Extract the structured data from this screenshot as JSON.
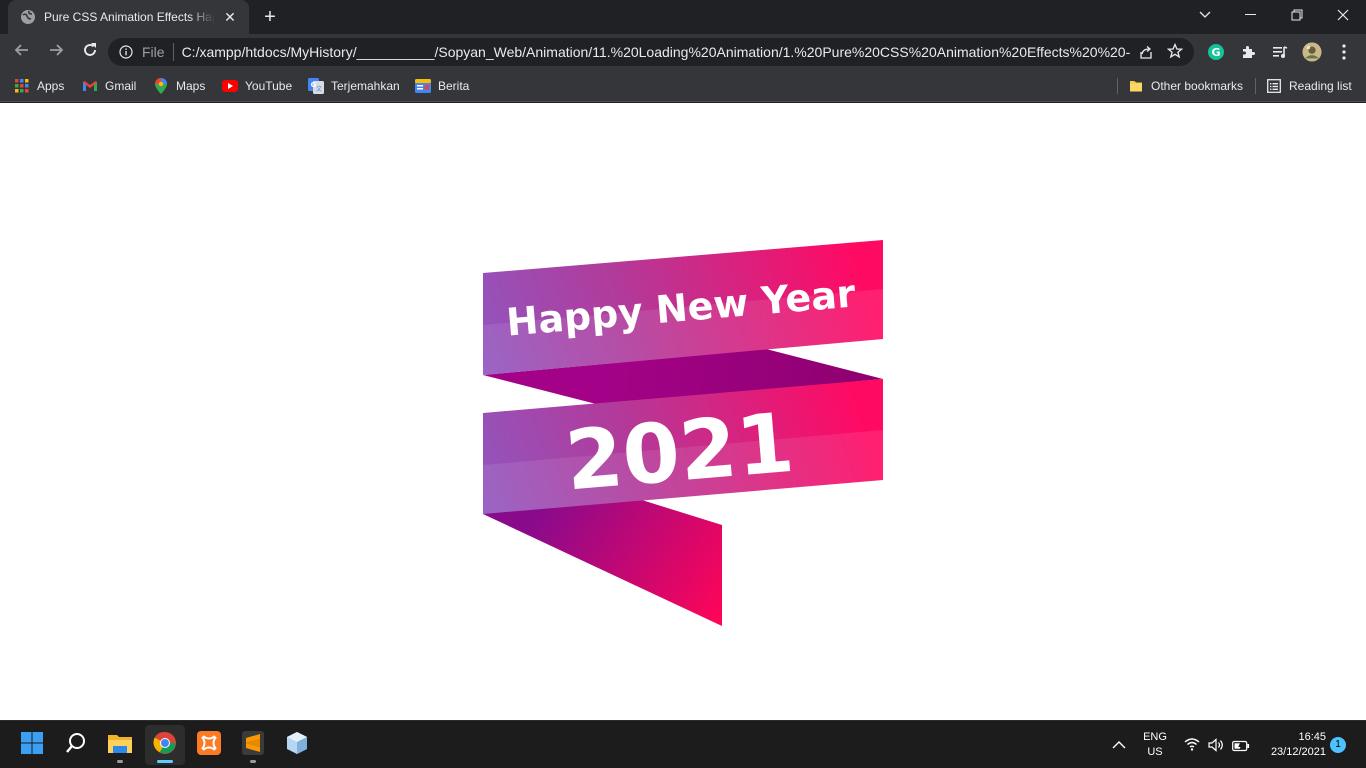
{
  "browser": {
    "tab": {
      "title": "Pure CSS Animation Effects Happy New Year",
      "close_symbol": "✕",
      "favicon": "globe-icon"
    },
    "new_tab_symbol": "+",
    "window_controls": {
      "tab_search": "⌵",
      "minimize": "—",
      "restore": "❐",
      "close": "✕"
    },
    "omnibox": {
      "scheme_label": "File",
      "url": "C:/xampp/htdocs/MyHistory/__________/Sopyan_Web/Animation/11.%20Loading%20Animation/1.%20Pure%20CSS%20Animation%20Effects%20%20-..."
    },
    "extensions": [
      "grammarly-icon",
      "puzzle-icon",
      "media-queue-icon",
      "profile-avatar"
    ],
    "bookmarks": [
      {
        "label": "Apps",
        "icon": "apps-grid-icon"
      },
      {
        "label": "Gmail",
        "icon": "gmail-icon"
      },
      {
        "label": "Maps",
        "icon": "maps-icon"
      },
      {
        "label": "YouTube",
        "icon": "youtube-icon"
      },
      {
        "label": "Terjemahkan",
        "icon": "translate-icon"
      },
      {
        "label": "Berita",
        "icon": "news-icon"
      }
    ],
    "other_bookmarks": "Other bookmarks",
    "reading_list": "Reading list"
  },
  "page": {
    "banner_line1": "Happy New Year",
    "banner_line2": "2021",
    "colors": {
      "magenta": "#ff0a63",
      "purple": "#8a2fa8",
      "lavender": "#8a5cc7",
      "fold_dark": "#960282"
    }
  },
  "taskbar": {
    "apps": [
      "windows-start-icon",
      "search-icon",
      "file-explorer-icon",
      "chrome-icon",
      "xampp-icon",
      "sublime-text-icon",
      "virtualbox-icon"
    ],
    "tray": {
      "chevron": "^",
      "lang": "ENG",
      "region": "US",
      "time": "16:45",
      "date": "23/12/2021",
      "notifications": "1"
    }
  }
}
